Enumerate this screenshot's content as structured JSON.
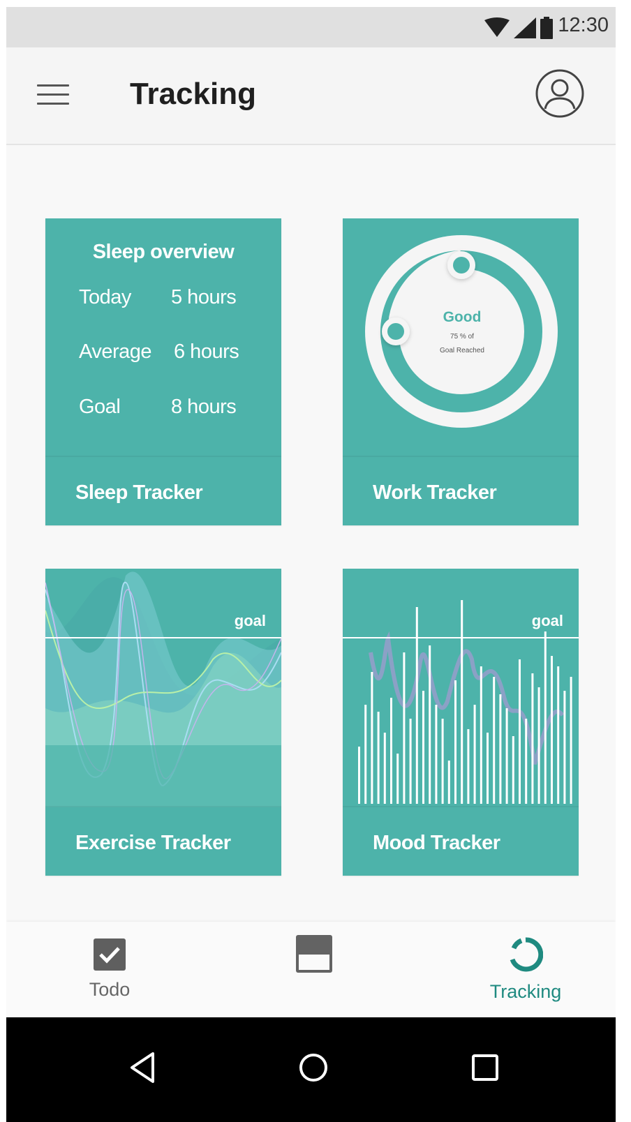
{
  "status_bar": {
    "time": "12:30",
    "icons": [
      "wifi-icon",
      "signal-icon",
      "battery-icon"
    ]
  },
  "app_bar": {
    "title": "Tracking",
    "menu_icon": "menu-icon",
    "account_icon": "account-circle-icon"
  },
  "cards": {
    "sleep": {
      "title": "Sleep overview",
      "rows": [
        {
          "label": "Today",
          "value": "5 hours"
        },
        {
          "label": "Average",
          "value": "6 hours"
        },
        {
          "label": "Goal",
          "value": "8 hours"
        }
      ],
      "footer": "Sleep Tracker"
    },
    "work": {
      "status": "Good",
      "progress_line1": "75 % of",
      "progress_line2": "Goal Reached",
      "progress_percent": 75,
      "footer": "Work Tracker"
    },
    "exercise": {
      "goal_label": "goal",
      "footer": "Exercise Tracker"
    },
    "mood": {
      "goal_label": "goal",
      "footer": "Mood Tracker"
    }
  },
  "bottom_nav": {
    "items": [
      {
        "label": "Todo",
        "icon": "checkbox-icon"
      },
      {
        "label": "",
        "icon": "calendar-icon"
      },
      {
        "label": "Tracking",
        "icon": "tracking-ring-icon"
      }
    ],
    "active_color": "#1f8a80"
  },
  "system_nav": {
    "buttons": [
      "back-icon",
      "home-icon",
      "recents-icon"
    ]
  },
  "colors": {
    "card": "#4db3aa",
    "accent": "#1f8a80",
    "appbar": "#f5f5f5"
  }
}
